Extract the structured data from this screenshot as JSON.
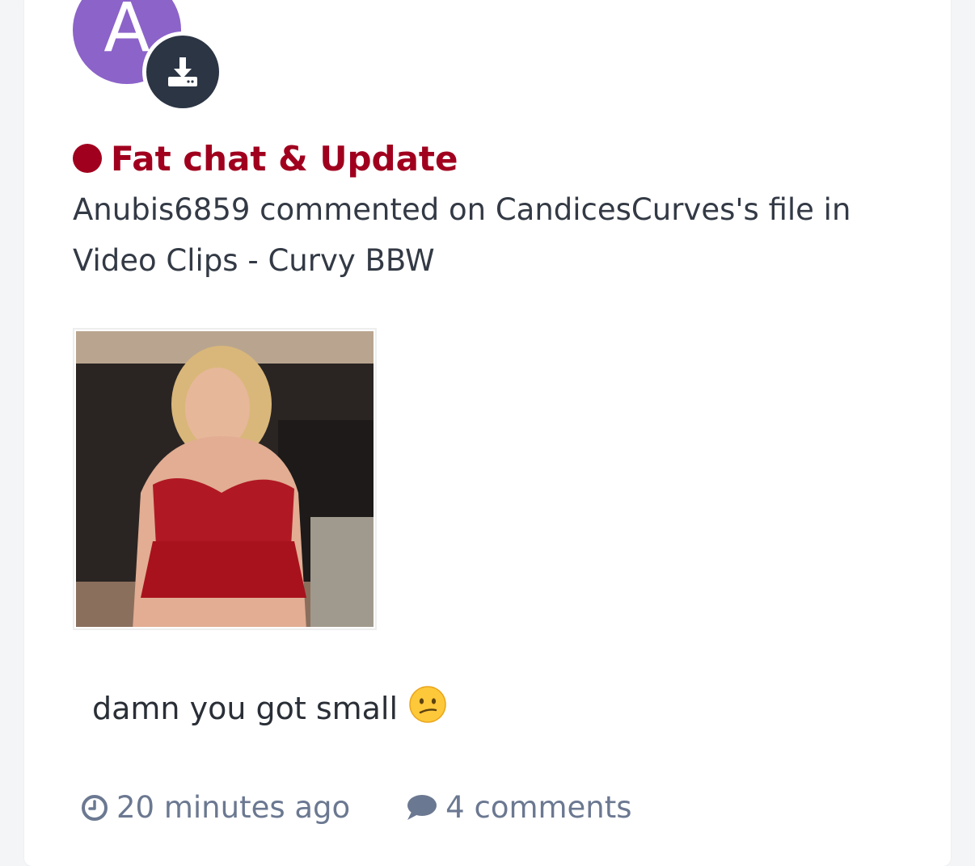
{
  "avatar": {
    "initial": "A",
    "color": "#8c63c9",
    "badge_icon": "download-icon",
    "badge_color": "#2b3544"
  },
  "post": {
    "status_color": "#a0001e",
    "title": "Fat chat & Update",
    "activity_text": "Anubis6859 commented on CandicesCurves's file in Video Clips - Curvy BBW",
    "thumbnail_alt": "photo thumbnail",
    "comment_text": "damn you got small",
    "comment_emoji": "confused-face-emoji"
  },
  "meta": {
    "time_icon": "clock-icon",
    "time": "20 minutes ago",
    "comments_icon": "comment-bubble-icon",
    "comments": "4 comments"
  }
}
